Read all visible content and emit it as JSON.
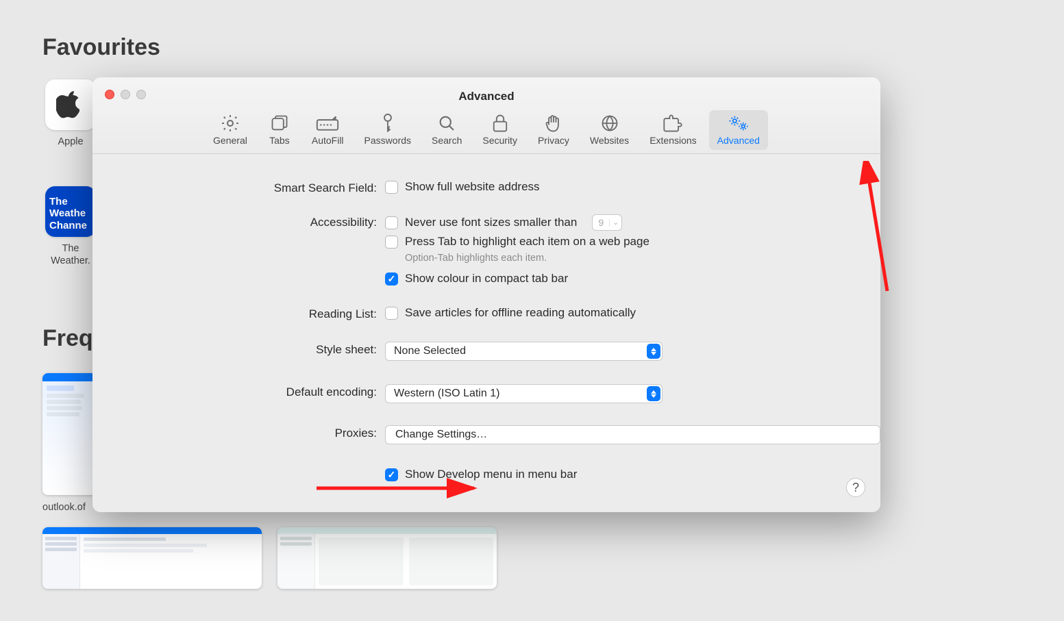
{
  "page": {
    "favourites_title": "Favourites",
    "frequently_title": "Frequ",
    "bookmarks": {
      "apple": {
        "label": "Apple"
      },
      "weather": {
        "line1": "The",
        "line2": "Weathe",
        "line3": "Channe",
        "label": "The Weather."
      }
    },
    "thumb_label": "outlook.of"
  },
  "window": {
    "title": "Advanced",
    "tabs": {
      "general": "General",
      "tabs": "Tabs",
      "autofill": "AutoFill",
      "passwords": "Passwords",
      "search": "Search",
      "security": "Security",
      "privacy": "Privacy",
      "websites": "Websites",
      "extensions": "Extensions",
      "advanced": "Advanced"
    },
    "form": {
      "smart_search_label": "Smart Search Field:",
      "smart_search_check": "Show full website address",
      "accessibility_label": "Accessibility:",
      "never_font_check": "Never use font sizes smaller than",
      "font_size_value": "9",
      "press_tab_check": "Press Tab to highlight each item on a web page",
      "option_tab_hint": "Option-Tab highlights each item.",
      "show_colour_check": "Show colour in compact tab bar",
      "reading_list_label": "Reading List:",
      "save_articles_check": "Save articles for offline reading automatically",
      "style_sheet_label": "Style sheet:",
      "style_sheet_value": "None Selected",
      "default_encoding_label": "Default encoding:",
      "default_encoding_value": "Western (ISO Latin 1)",
      "proxies_label": "Proxies:",
      "proxies_button": "Change Settings…",
      "develop_check": "Show Develop menu in menu bar"
    },
    "help": "?"
  }
}
